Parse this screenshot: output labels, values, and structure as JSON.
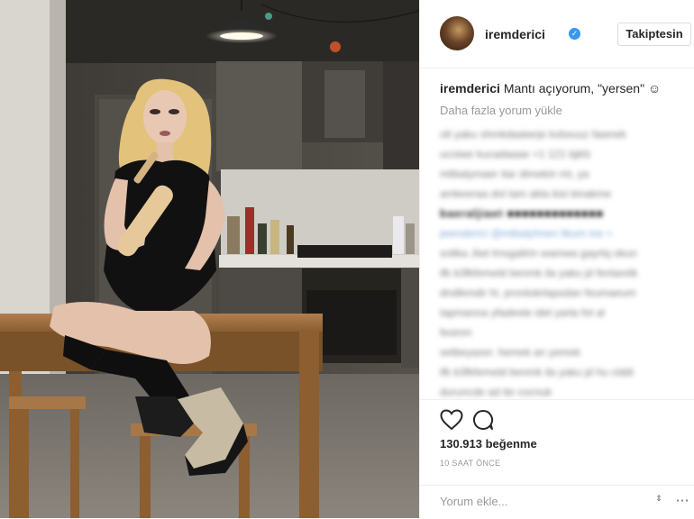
{
  "post": {
    "username": "iremderici",
    "follow_label": "Takiptesin",
    "caption_user": "iremderici",
    "caption_text": " Mantı açıyorum, \"yersen\" ☺",
    "load_more": "Daha fazla yorum yükle",
    "comments": [
      "olt yaku shmkdaaiwrje kvbxuuz fawnek",
      "ucoiwe kucadaaae +1 121 bjkfz",
      "mlibalymaer itar dimekin mt, ya",
      "amkeeraa dol tam akla kisi kinakme",
      "baeraljiaet ■■■■■■■■■■■■■",
      "jwenderici @mtbalyhnen likum ine +",
      "solika Jiwt lmsgalirin wamwa gayrtq okun",
      "ifk b3fkfemeld benmk ila yaku jd fentarelk",
      "dndikmdir hi, prontokrlapsdan feumaeum",
      "tapmanna yfadeele idel yarla fot al",
      "fesinm",
      "setbeyazer. hemek an yemek",
      "ifk b3fkfemeld benmk ila yaku jd hu ciddi",
      "duruncde ad ite cocnuk"
    ],
    "likes": "130.913 beğenme",
    "time_ago": "10 SAAT ÖNCE",
    "comment_placeholder": "Yorum ekle...",
    "stepper_glyph": "⇕",
    "more_glyph": "⋯"
  },
  "colors": {
    "verified": "#3897f0",
    "border": "#efefef",
    "muted": "#999999"
  },
  "icons": [
    "verified-badge-icon",
    "heart-icon",
    "comment-bubble-icon",
    "stepper-icon",
    "more-options-icon"
  ]
}
